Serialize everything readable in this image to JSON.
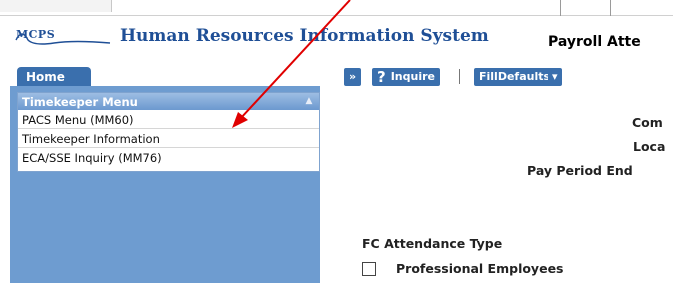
{
  "header": {
    "logo_text": "MCPS",
    "app_title": "Human Resources Information System",
    "page_title": "Payroll Atte"
  },
  "nav": {
    "home_tab": "Home"
  },
  "sidebar": {
    "menu_title": "Timekeeper Menu",
    "items": [
      {
        "label": "PACS Menu (MM60)"
      },
      {
        "label": "Timekeeper Information"
      },
      {
        "label": "ECA/SSE Inquiry (MM76)"
      }
    ]
  },
  "toolbar": {
    "expand_label": "»",
    "inquire_label": "Inquire",
    "separator": "|",
    "filldefaults_label": "FillDefaults",
    "dropdown_label": "▾"
  },
  "form": {
    "label_com": "Com",
    "label_loca": "Loca",
    "label_pay_period_end": "Pay Period End",
    "fc_attendance_type": "FC Attendance Type",
    "professional_employees": "Professional Employees"
  },
  "colors": {
    "brand_blue": "#1f4f96",
    "menu_blue": "#3a6fad",
    "sidebar_blue": "#6e9cd0",
    "annotation_red": "#e00000"
  }
}
